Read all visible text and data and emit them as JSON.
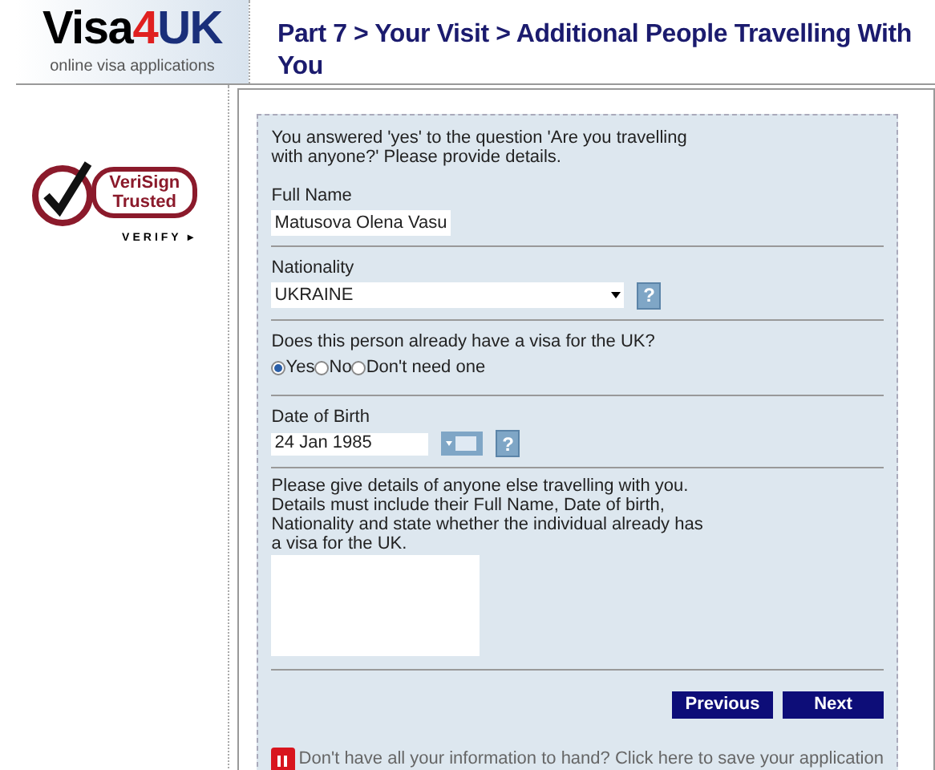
{
  "logo": {
    "brand": "Visa",
    "brand_number": "4",
    "brand_accent": "UK",
    "tagline": "online visa applications"
  },
  "page_title": "Part 7 > Your Visit > Additional People Travelling With You",
  "trust_seal": {
    "line_1": "VeriSign",
    "line_2": "Trusted",
    "verify": "VERIFY ▸"
  },
  "intro": "You answered 'yes' to the question 'Are you travelling with anyone?' Please provide details.",
  "full_name": {
    "label": "Full Name",
    "value": "Matusova Olena Vasu"
  },
  "nationality": {
    "label": "Nationality",
    "value": "UKRAINE",
    "help": "?"
  },
  "has_visa": {
    "label": "Does this person already have a visa for the UK?",
    "options": [
      {
        "label": "Yes",
        "selected": true
      },
      {
        "label": "No",
        "selected": false
      },
      {
        "label": "Don't need one",
        "selected": false
      }
    ]
  },
  "date_of_birth": {
    "label": "Date of Birth",
    "value": "24 Jan 1985",
    "help": "?"
  },
  "others": {
    "label": "Please give details of anyone else travelling with you. Details must include their Full Name, Date of birth, Nationality and state whether the individual already has a visa for the UK."
  },
  "buttons": [
    "Previous",
    "Next"
  ],
  "save_link": "Don't have all your information to hand? Click here to save your application"
}
